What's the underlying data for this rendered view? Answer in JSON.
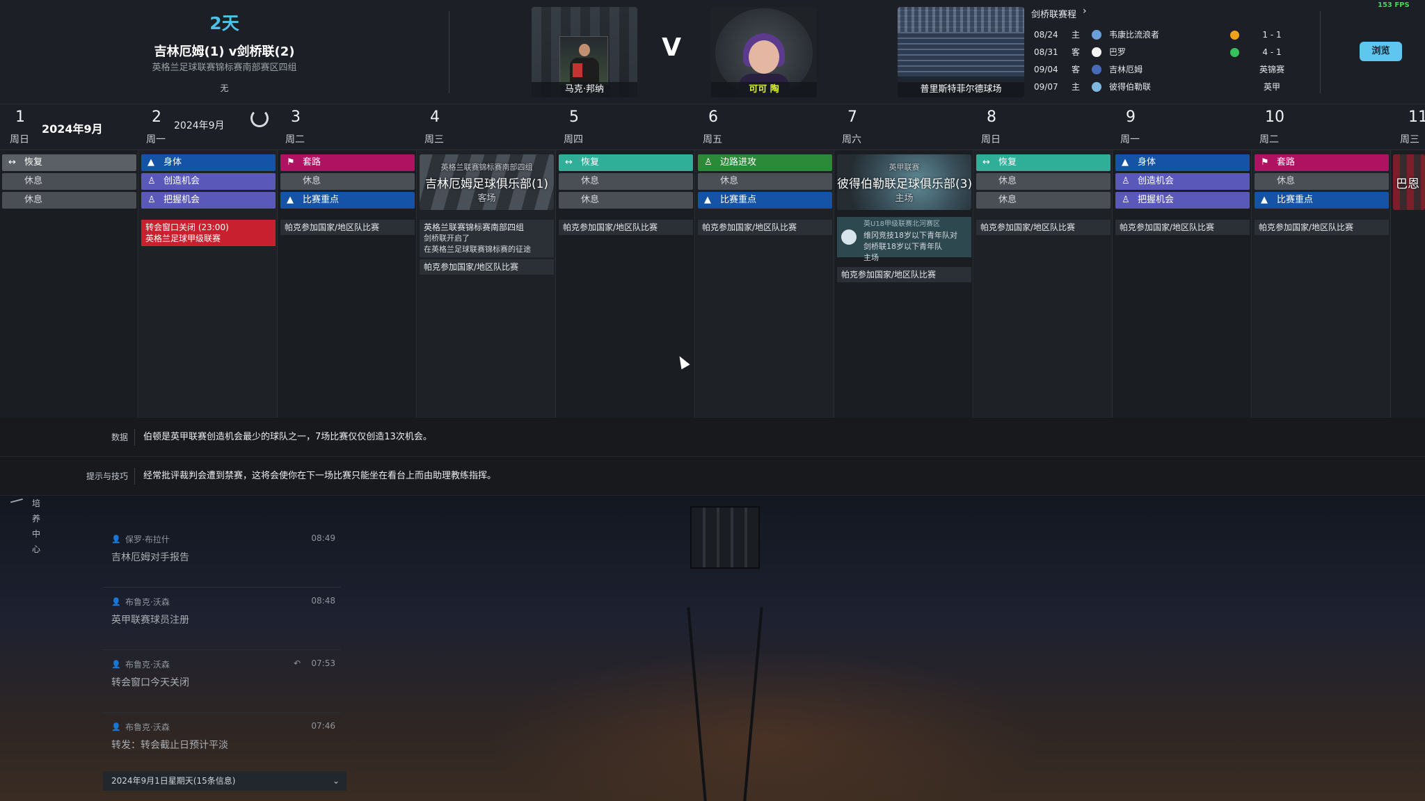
{
  "header": {
    "countdown": "2天",
    "match_title": "吉林厄姆(1) v剑桥联(2)",
    "competition": "英格兰足球联赛锦标赛南部赛区四组",
    "note": "无",
    "vs": "V",
    "player_name": "马克·邦纳",
    "staff_name": "可可 陶",
    "stadium_name": "普里斯特菲尔德球场",
    "fps": "153 FPS",
    "browse_label": "浏览"
  },
  "fixtures": {
    "title": "剑桥联赛程",
    "arrow": "›",
    "rows": [
      {
        "date": "08/24",
        "ha": "主",
        "team": "韦康比流浪者",
        "result": "1 - 1",
        "badge_color": "#6aa0d8",
        "dot_color": "#f0a21a"
      },
      {
        "date": "08/31",
        "ha": "客",
        "team": "巴罗",
        "result": "4 - 1",
        "badge_color": "#f4f4f4",
        "dot_color": "#36c15d"
      },
      {
        "date": "09/04",
        "ha": "客",
        "team": "吉林厄姆",
        "result": "英锦赛",
        "badge_color": "#4a69b8",
        "dot_color": ""
      },
      {
        "date": "09/07",
        "ha": "主",
        "team": "彼得伯勒联",
        "result": "英甲",
        "badge_color": "#7fb7de",
        "dot_color": ""
      }
    ]
  },
  "calendar": {
    "month_label": "2024年9月",
    "month_label_small": "2024年9月",
    "days": [
      {
        "num": "1",
        "wd": "周日"
      },
      {
        "num": "2",
        "wd": "周一"
      },
      {
        "num": "3",
        "wd": "周二"
      },
      {
        "num": "4",
        "wd": "周三"
      },
      {
        "num": "5",
        "wd": "周四"
      },
      {
        "num": "6",
        "wd": "周五"
      },
      {
        "num": "7",
        "wd": "周六"
      },
      {
        "num": "8",
        "wd": "周日"
      },
      {
        "num": "9",
        "wd": "周一"
      },
      {
        "num": "10",
        "wd": "周二"
      },
      {
        "num": "11",
        "wd": "周三"
      }
    ],
    "sessions": {
      "recovery": "恢复",
      "rest": "休息",
      "physical": "身体",
      "chance_creation": "创造机会",
      "chance_conversion": "把握机会",
      "set_pieces": "套路",
      "match_focus": "比赛重点",
      "wing_attack": "边路进攻"
    },
    "match_day4": {
      "comp": "英格兰联赛锦标赛南部四组",
      "name": "吉林厄姆足球俱乐部(1)",
      "ha": "客场"
    },
    "match_day7": {
      "comp": "英甲联赛",
      "name": "彼得伯勒联足球俱乐部(3)",
      "ha": "主场"
    },
    "partial_col_text": "巴恩",
    "events": {
      "transfer_close": "转会窗口关闭 (23:00)",
      "transfer_close_sub": "英格兰足球甲级联赛",
      "intl": "帕克参加国家/地区队比赛",
      "day4_line1": "英格兰联赛锦标赛南部四组",
      "day4_line2": "剑桥联开启了",
      "day4_line3": "在英格兰足球联赛锦标赛的征途",
      "u18_comp": "英U18甲级联赛北河赛区",
      "u18_line1": "维冈竞技18岁以下青年队对",
      "u18_line2": "剑桥联18岁以下青年队",
      "u18_line3": "主场"
    }
  },
  "tips": {
    "data_label": "数据",
    "data_text": "伯顿是英甲联赛创造机会最少的球队之一，7场比赛仅仅创造13次机会。",
    "hint_label": "提示与技巧",
    "hint_text": "经常批评裁判会遭到禁赛，这将会使你在下一场比赛只能坐在看台上而由助理教练指挥。"
  },
  "inbox": {
    "title": "培养中心",
    "messages": [
      {
        "sender": "保罗·布拉什",
        "time": "08:49",
        "subject": "吉林厄姆对手报告",
        "reply": ""
      },
      {
        "sender": "布鲁克·沃森",
        "time": "08:48",
        "subject": "英甲联赛球员注册",
        "reply": ""
      },
      {
        "sender": "布鲁克·沃森",
        "time": "07:53",
        "subject": "转会窗口今天关闭",
        "reply": "↶"
      },
      {
        "sender": "布鲁克·沃森",
        "time": "07:46",
        "subject": "转发：转会截止日预计平淡",
        "reply": ""
      }
    ],
    "day_bar": "2024年9月1日星期天(15条信息)",
    "day_bar_arrow": "⌄"
  }
}
